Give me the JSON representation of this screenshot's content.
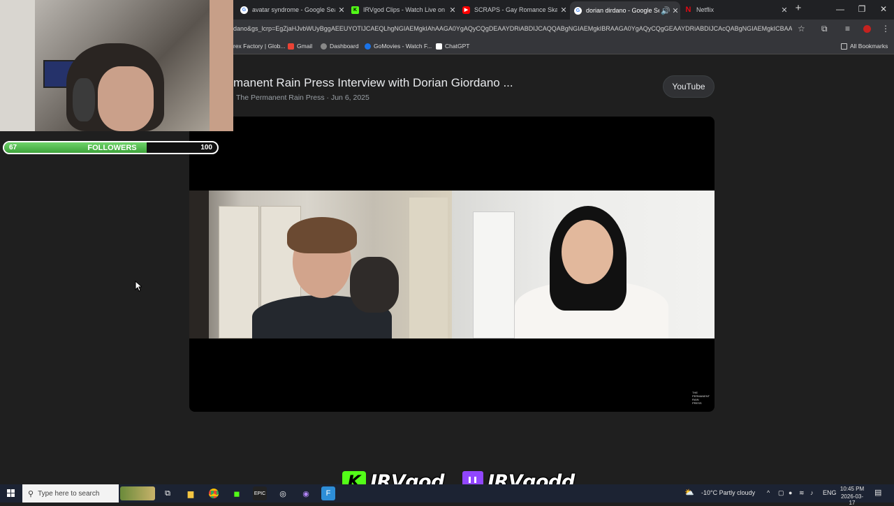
{
  "tabs": [
    {
      "title": "avatar syndrome - Google Sea",
      "favicon": "google-icon",
      "active": false
    },
    {
      "title": "IRVgod Clips - Watch Live on K",
      "favicon": "kick-icon",
      "active": false
    },
    {
      "title": "SCRAPS - Gay Romance Skateb",
      "favicon": "youtube-icon",
      "active": false
    },
    {
      "title": "dorian dirdano - Google Se",
      "favicon": "google-icon",
      "active": true
    },
    {
      "title": "Netflix",
      "favicon": "netflix-icon",
      "active": false
    }
  ],
  "address_bar": {
    "url": "dano&gs_lcrp=EgZjaHJvbWUyBggAEEUYOTIJCAEQLhgNGIAEMgkIAhAAGA0YgAQyCQgDEAAYDRiABDIJCAQQABgNGIAEMgkIBRAAGA0YgAQyCQgGEAAYDRiABDIJCAcQABgNGIAEMgkICBAAGA..."
  },
  "bookmarks": [
    {
      "label": "rex Factory | Glob..."
    },
    {
      "label": "Gmail"
    },
    {
      "label": "Dashboard"
    },
    {
      "label": "GoMovies - Watch F..."
    },
    {
      "label": "ChatGPT"
    }
  ],
  "all_bookmarks_label": "All Bookmarks",
  "video": {
    "title": "manent Rain Press Interview with Dorian Giordano ...",
    "meta": "The Permanent Rain Press · Jun 6, 2025",
    "source_chip": "YouTube",
    "watermark": "THE PERMANENT RAIN PRESS"
  },
  "followers_goal": {
    "label": "FOLLOWERS",
    "current": "67",
    "goal": "100",
    "progress_fraction": 0.67
  },
  "stream_overlay": {
    "kick_handle": "IRVgod",
    "twitch_handle": "IRVgodd"
  },
  "taskbar": {
    "search_placeholder": "Type here to search",
    "weather": "-10°C  Partly cloudy",
    "language": "ENG",
    "time": "10:45 PM",
    "date": "2026-03-17"
  },
  "colors": {
    "kick_green": "#53fc18",
    "twitch_purple": "#9146ff",
    "progress_green": "#4cbb47"
  }
}
